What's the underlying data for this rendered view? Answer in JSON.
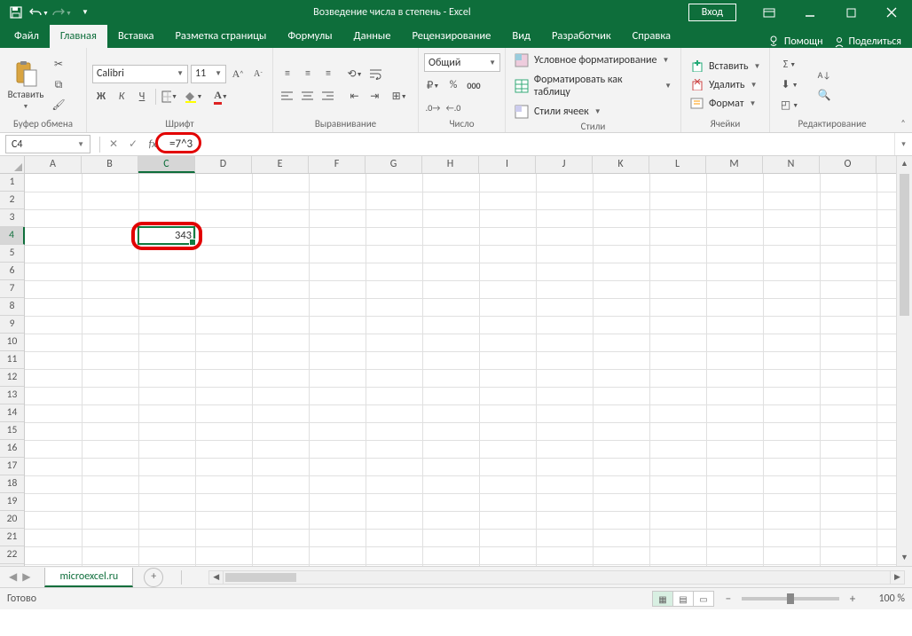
{
  "title": "Возведение числа в степень  -  Excel",
  "login_btn": "Вход",
  "tabs": {
    "file": "Файл",
    "home": "Главная",
    "insert": "Вставка",
    "layout": "Разметка страницы",
    "formulas": "Формулы",
    "data": "Данные",
    "review": "Рецензирование",
    "view": "Вид",
    "developer": "Разработчик",
    "help": "Справка",
    "assist": "Помощн",
    "share": "Поделиться"
  },
  "ribbon": {
    "clipboard": {
      "paste": "Вставить",
      "label": "Буфер обмена"
    },
    "font": {
      "label": "Шрифт",
      "name": "Calibri",
      "size": "11",
      "b": "Ж",
      "i": "К",
      "u": "Ч"
    },
    "align": {
      "label": "Выравнивание"
    },
    "number": {
      "label": "Число",
      "format": "Общий"
    },
    "styles": {
      "label": "Стили",
      "cond": "Условное форматирование",
      "table": "Форматировать как таблицу",
      "cell": "Стили ячеек"
    },
    "cells": {
      "label": "Ячейки",
      "insert": "Вставить",
      "delete": "Удалить",
      "format": "Формат"
    },
    "editing": {
      "label": "Редактирование"
    }
  },
  "namebox": "C4",
  "formula": "=7^3",
  "columns": [
    "A",
    "B",
    "C",
    "D",
    "E",
    "F",
    "G",
    "H",
    "I",
    "J",
    "K",
    "L",
    "M",
    "N",
    "O"
  ],
  "rows": [
    "1",
    "2",
    "3",
    "4",
    "5",
    "6",
    "7",
    "8",
    "9",
    "10",
    "11",
    "12",
    "13",
    "14",
    "15",
    "16",
    "17",
    "18",
    "19",
    "20",
    "21",
    "22"
  ],
  "active_col": 2,
  "active_row": 3,
  "cell_value": "343",
  "sheet_name": "microexcel.ru",
  "status_ready": "Готово",
  "zoom": "100 %"
}
